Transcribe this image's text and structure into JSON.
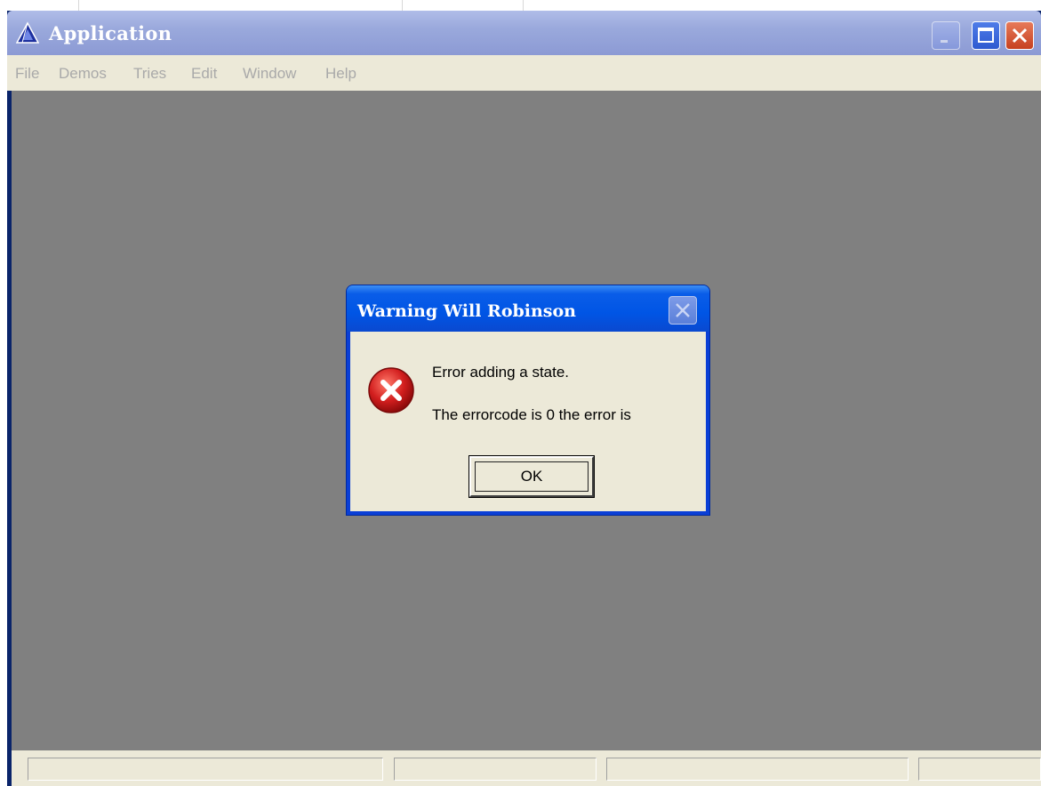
{
  "app": {
    "title": "Application",
    "icon": "app-triangle-icon"
  },
  "titlebar_buttons": {
    "minimize": "minimize-icon",
    "maximize": "maximize-icon",
    "close": "close-icon"
  },
  "menu": [
    "File",
    "Demos",
    "Tries",
    "Edit",
    "Window",
    "Help"
  ],
  "menu_state": "disabled",
  "dialog": {
    "title": "Warning Will Robinson",
    "icon": "error-icon",
    "message_line1": "Error adding a state.",
    "message_line2": "The errorcode is 0 the error is",
    "ok_label": "OK"
  },
  "colors": {
    "mdi_background": "#808080",
    "dialog_title": "#0055e5",
    "error_red": "#d21e1e",
    "face": "#ece9d8"
  },
  "statusbar": {
    "panes": [
      "",
      "",
      "",
      ""
    ]
  }
}
